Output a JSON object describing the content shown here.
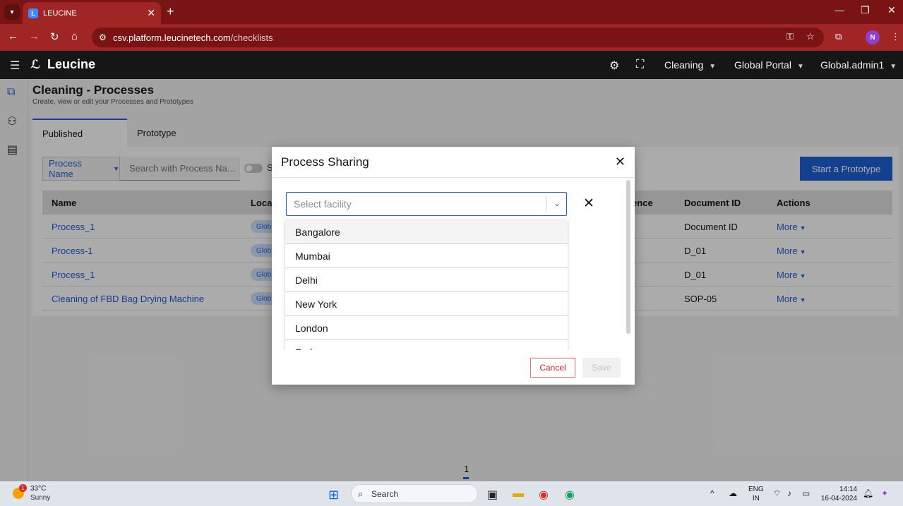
{
  "browser": {
    "tab_title": "LEUCINE",
    "url_domain": "csv.platform.leucinetech.com",
    "url_path": "/checklists",
    "profile_initial": "N"
  },
  "app": {
    "logo_text": "Leucine",
    "header_menus": [
      "Cleaning",
      "Global Portal",
      "Global.admin1"
    ]
  },
  "page": {
    "title": "Cleaning - Processes",
    "subtitle": "Create, view or edit your Processes and Prototypes",
    "tabs": [
      "Published",
      "Prototype"
    ],
    "filter_label": "Process Name",
    "search_placeholder": "Search with Process Na...",
    "toggle_label": "S",
    "start_prototype_label": "Start a Prototype"
  },
  "table": {
    "headers": {
      "name": "Name",
      "local": "Local",
      "reference": "rence",
      "document_id": "Document ID",
      "actions": "Actions"
    },
    "rows": [
      {
        "name": "Process_1",
        "chip": "Glob",
        "document_id": "Document ID",
        "action": "More"
      },
      {
        "name": "Process-1",
        "chip": "Glob",
        "document_id": "D_01",
        "action": "More"
      },
      {
        "name": "Process_1",
        "chip": "Glob",
        "document_id": "D_01",
        "action": "More"
      },
      {
        "name": "Cleaning of FBD Bag Drying Machine",
        "chip": "Glob",
        "document_id": "SOP-05",
        "action": "More"
      }
    ]
  },
  "pagination": {
    "current_page": "1"
  },
  "modal": {
    "title": "Process Sharing",
    "select_placeholder": "Select facility",
    "options": [
      "Bangalore",
      "Mumbai",
      "Delhi",
      "New York",
      "London",
      "Sydney"
    ],
    "cancel_label": "Cancel",
    "save_label": "Save"
  },
  "taskbar": {
    "temperature": "33°C",
    "weather": "Sunny",
    "weather_badge": "1",
    "search_label": "Search",
    "lang_line1": "ENG",
    "lang_line2": "IN",
    "time": "14:14",
    "date": "16-04-2024"
  }
}
